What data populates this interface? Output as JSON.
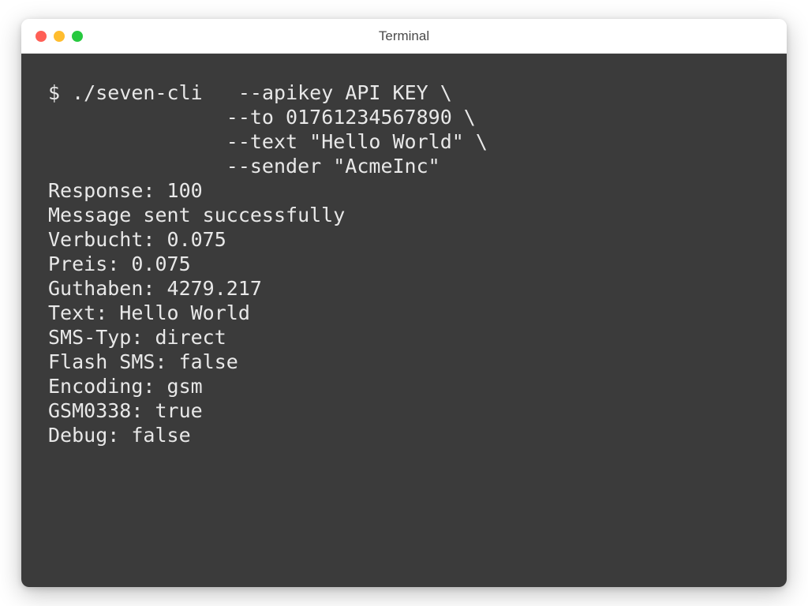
{
  "window": {
    "title": "Terminal"
  },
  "session": {
    "prompt": "$",
    "command": "./seven-cli",
    "indent": "               ",
    "args": [
      "--apikey API KEY \\",
      "--to 01761234567890 \\",
      "--text \"Hello World\" \\",
      "--sender \"AcmeInc\""
    ],
    "output": [
      "Response: 100",
      "Message sent successfully",
      "Verbucht: 0.075",
      "Preis: 0.075",
      "Guthaben: 4279.217",
      "Text: Hello World",
      "SMS-Typ: direct",
      "Flash SMS: false",
      "Encoding: gsm",
      "GSM0338: true",
      "Debug: false"
    ]
  }
}
